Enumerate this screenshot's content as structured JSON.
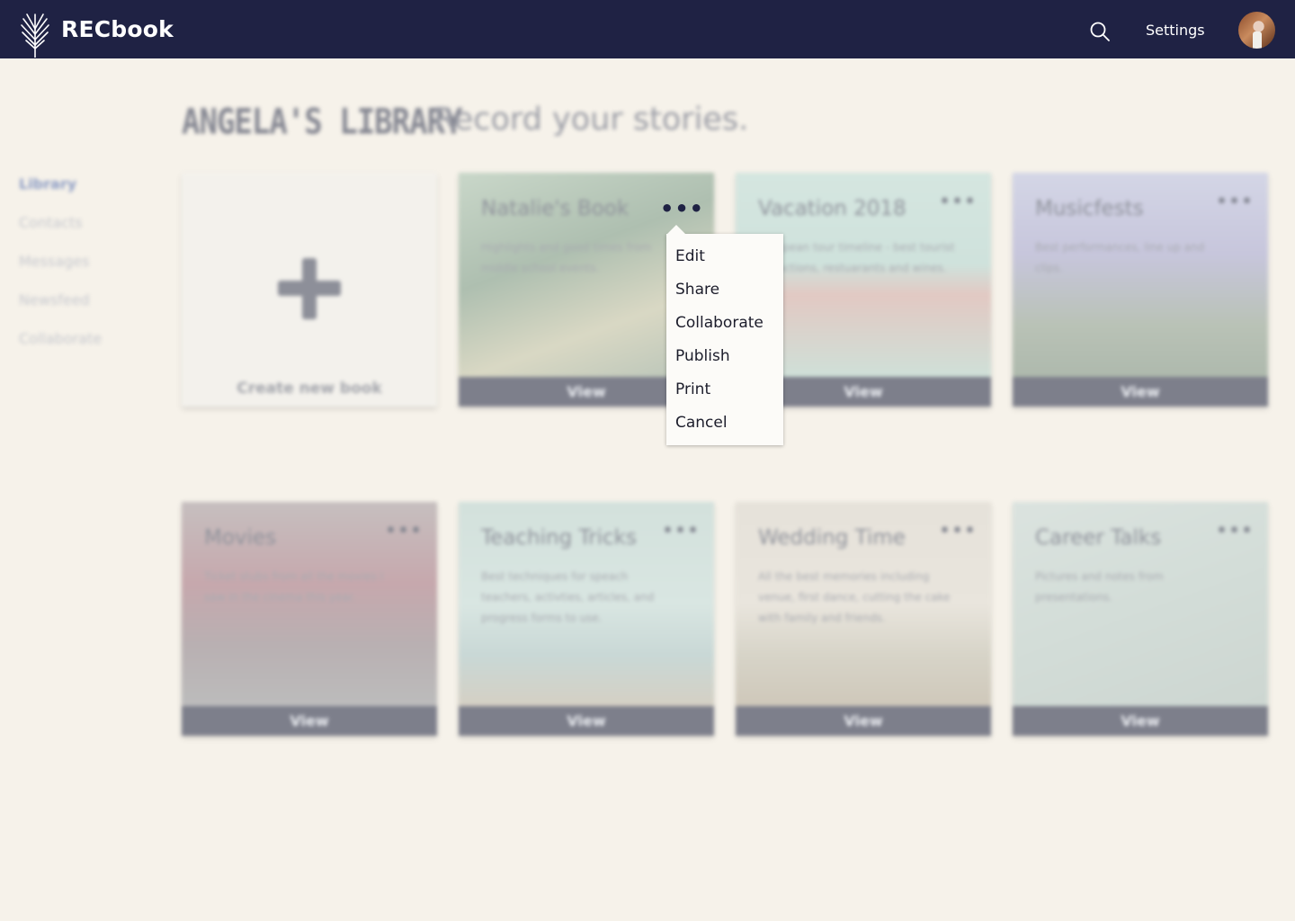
{
  "header": {
    "brand": "RECbook",
    "settings_label": "Settings"
  },
  "page": {
    "title": "ANGELA'S LIBRARY",
    "subtitle": "Record your stories."
  },
  "sidebar": {
    "items": [
      {
        "label": "Library",
        "active": true
      },
      {
        "label": "Contacts"
      },
      {
        "label": "Messages"
      },
      {
        "label": "Newsfeed"
      },
      {
        "label": "Collaborate"
      }
    ]
  },
  "create": {
    "label": "Create new book"
  },
  "books": [
    {
      "title": "Natalie's Book",
      "description": "Highlights and good times from middle school events.",
      "button": "View",
      "menu": "•••"
    },
    {
      "title": "Vacation 2018",
      "description": "European tour timeline - best tourist attractions, restuarants and wines.",
      "button": "View",
      "menu": "•••"
    },
    {
      "title": "Musicfests",
      "description": "Best performances, line up and clips.",
      "button": "View",
      "menu": "•••"
    },
    {
      "title": "Movies",
      "description": "Ticket stubs from all the movies I saw in the cinema this year.",
      "button": "View",
      "menu": "•••"
    },
    {
      "title": "Teaching Tricks",
      "description": "Best techniques for speach teachers, activties, articles, and progress forms to use.",
      "button": "View",
      "menu": "•••"
    },
    {
      "title": "Wedding Time",
      "description": "All the best memories including venue, first dance, cutting the cake with family and friends.",
      "button": "View",
      "menu": "•••"
    },
    {
      "title": "Career Talks",
      "description": "Pictures and notes from presentations.",
      "button": "View",
      "menu": "•••"
    }
  ],
  "context_menu": {
    "trigger": "•••",
    "items": [
      "Edit",
      "Share",
      "Collaborate",
      "Publish",
      "Print",
      "Cancel"
    ]
  },
  "colors": {
    "header_bg": "#1f2244",
    "page_bg": "#f6f2ea",
    "view_button": "#7d7f8b"
  },
  "icons": {
    "logo": "palm-leaf-icon",
    "search": "search-icon",
    "plus": "plus-icon",
    "more": "more-dots-icon"
  }
}
